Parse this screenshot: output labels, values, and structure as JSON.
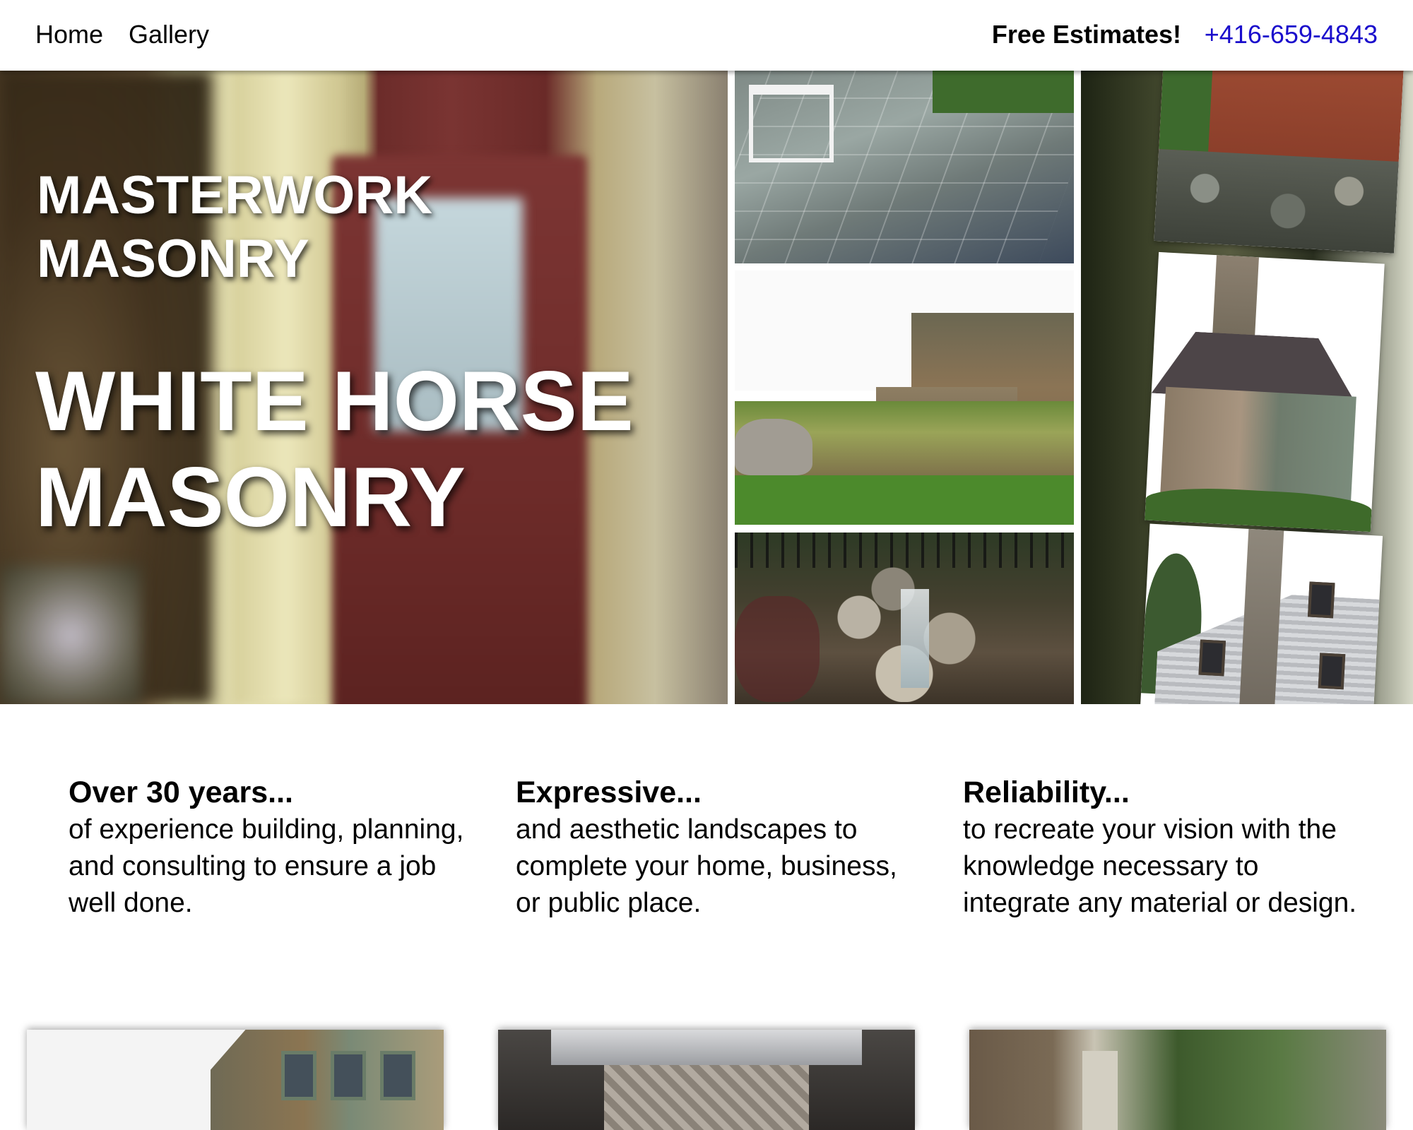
{
  "nav": {
    "home": "Home",
    "gallery": "Gallery",
    "estimates": "Free Estimates!",
    "phone": "+416-659-4843"
  },
  "hero": {
    "title_small": "MASTERWORK\nMASONRY",
    "title_big": "WHITE HORSE\nMASONRY"
  },
  "features": [
    {
      "title": "Over 30 years...",
      "text": "of experience building, planning, and consulting to ensure a job well done."
    },
    {
      "title": "Expressive...",
      "text": "and aesthetic landscapes to complete your home, business, or public place."
    },
    {
      "title": "Reliability...",
      "text": "to recreate your vision with the knowledge necessary to integrate any material or design."
    }
  ],
  "colors": {
    "link": "#1a0dcc",
    "text": "#000000",
    "hero_text": "#ffffff"
  }
}
